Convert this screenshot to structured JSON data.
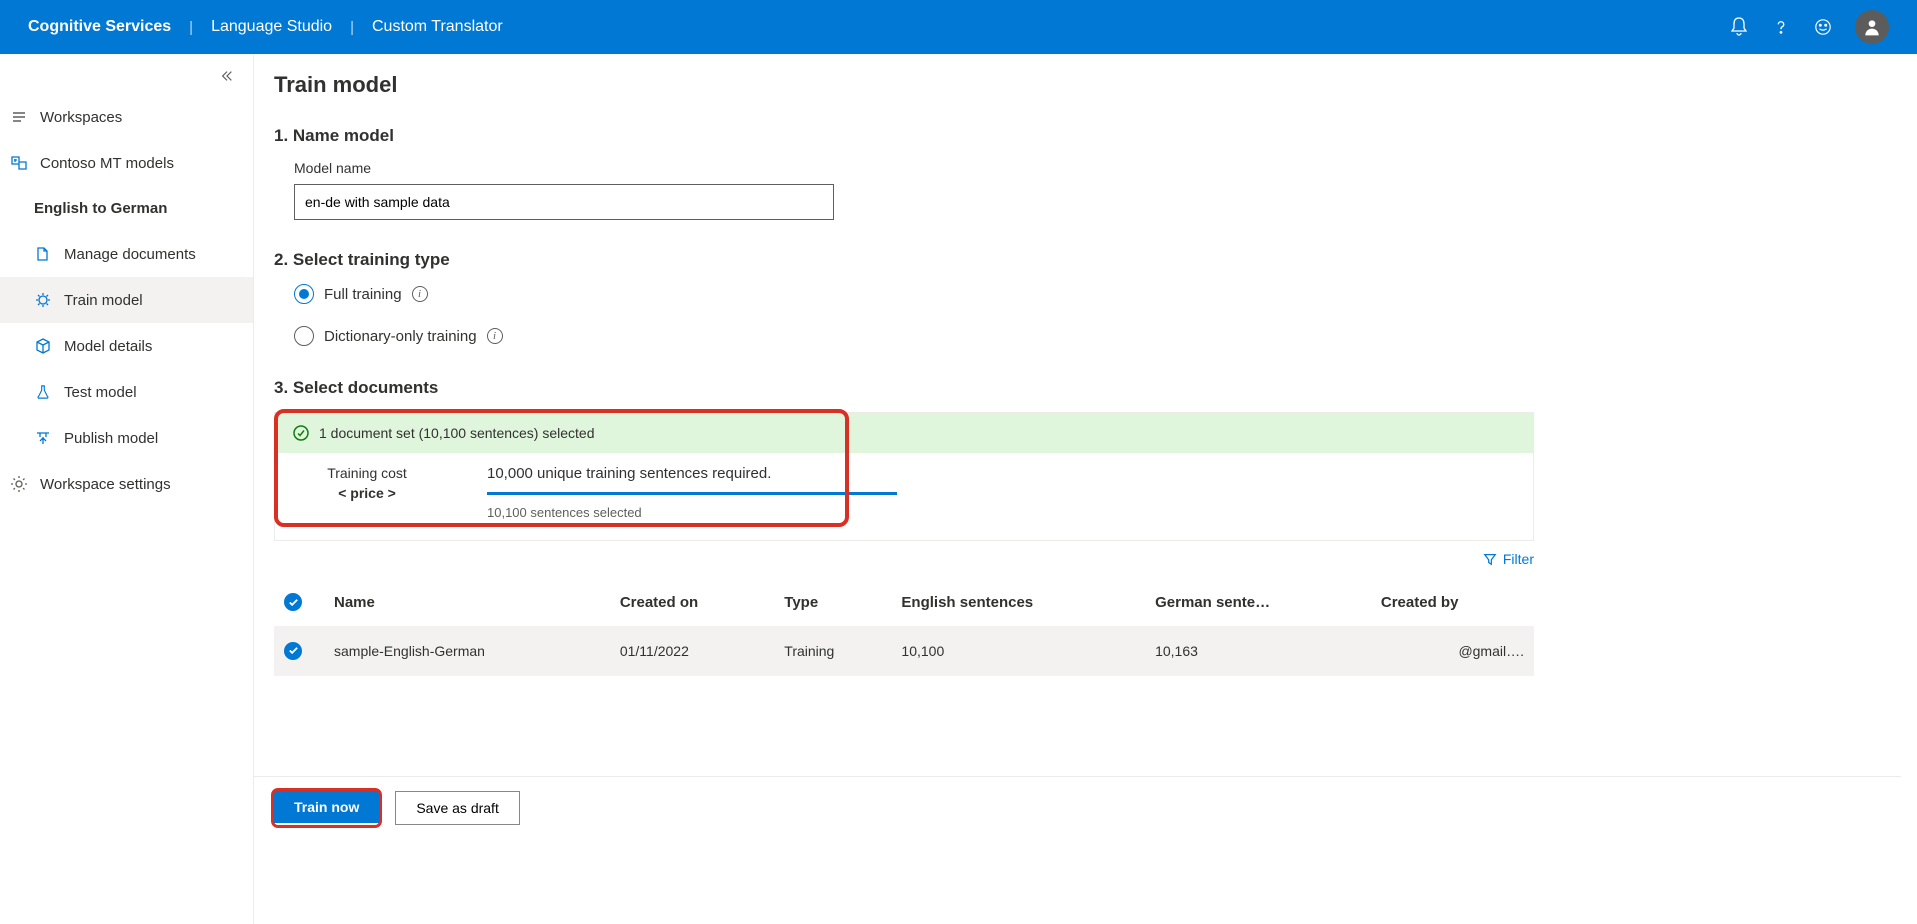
{
  "header": {
    "crumb1": "Cognitive Services",
    "crumb2": "Language Studio",
    "crumb3": "Custom Translator"
  },
  "sidebar": {
    "workspaces": "Workspaces",
    "workspace_name": "Contoso MT models",
    "project_name": "English to German",
    "items": [
      {
        "label": "Manage documents"
      },
      {
        "label": "Train model"
      },
      {
        "label": "Model details"
      },
      {
        "label": "Test model"
      },
      {
        "label": "Publish model"
      }
    ],
    "settings": "Workspace settings"
  },
  "main": {
    "title": "Train model",
    "step1_title": "1. Name model",
    "model_name_label": "Model name",
    "model_name_value": "en-de with sample data",
    "step2_title": "2. Select training type",
    "radio_full": "Full training",
    "radio_dict": "Dictionary-only training",
    "step3_title": "3. Select documents",
    "selected_summary": "1 document set (10,100 sentences) selected",
    "cost_label": "Training cost",
    "cost_value": "< price >",
    "requirement_line": "10,000 unique training sentences required.",
    "selected_line": "10,100 sentences selected",
    "filter": "Filter"
  },
  "table": {
    "cols": [
      "Name",
      "Created on",
      "Type",
      "English sentences",
      "German sente…",
      "Created by"
    ],
    "rows": [
      {
        "name": "sample-English-German",
        "created_on": "01/11/2022",
        "type": "Training",
        "en": "10,100",
        "de": "10,163",
        "by": "@gmail…."
      }
    ]
  },
  "footer": {
    "train": "Train now",
    "save": "Save as draft"
  }
}
